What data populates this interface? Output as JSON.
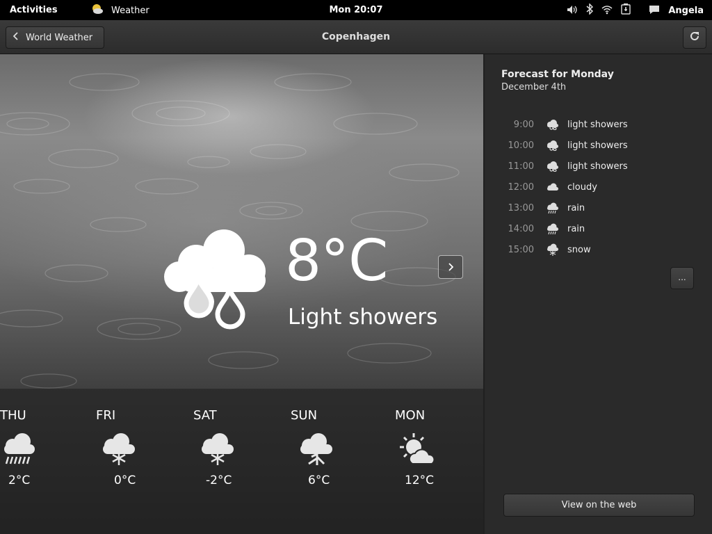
{
  "topbar": {
    "activities": "Activities",
    "app_name": "Weather",
    "clock": "Mon 20:07",
    "user": "Angela",
    "icons": [
      "weather-app-icon",
      "volume-icon",
      "bluetooth-icon",
      "wifi-icon",
      "battery-icon",
      "chat-icon"
    ]
  },
  "header": {
    "back_label": "World Weather",
    "title": "Copenhagen",
    "refresh_icon": "refresh-icon"
  },
  "current": {
    "temperature": "8°C",
    "condition": "Light showers",
    "icon": "light-showers-icon"
  },
  "daily": [
    {
      "day": "THU",
      "temp": "2°C",
      "icon": "rain-icon"
    },
    {
      "day": "FRI",
      "temp": "0°C",
      "icon": "snow-icon"
    },
    {
      "day": "SAT",
      "temp": "-2°C",
      "icon": "snow-icon"
    },
    {
      "day": "SUN",
      "temp": "6°C",
      "icon": "storm-icon"
    },
    {
      "day": "MON",
      "temp": "12°C",
      "icon": "partly-sunny-icon"
    }
  ],
  "sidebar": {
    "title": "Forecast for Monday",
    "date": "December 4th",
    "hourly": [
      {
        "time": "9:00",
        "desc": "light showers",
        "icon": "light-showers-icon"
      },
      {
        "time": "10:00",
        "desc": "light showers",
        "icon": "light-showers-icon"
      },
      {
        "time": "11:00",
        "desc": "light showers",
        "icon": "light-showers-icon"
      },
      {
        "time": "12:00",
        "desc": "cloudy",
        "icon": "cloud-icon"
      },
      {
        "time": "13:00",
        "desc": "rain",
        "icon": "rain-icon"
      },
      {
        "time": "14:00",
        "desc": "rain",
        "icon": "rain-icon"
      },
      {
        "time": "15:00",
        "desc": "snow",
        "icon": "snow-icon"
      }
    ],
    "more_label": "...",
    "web_label": "View on the web"
  }
}
